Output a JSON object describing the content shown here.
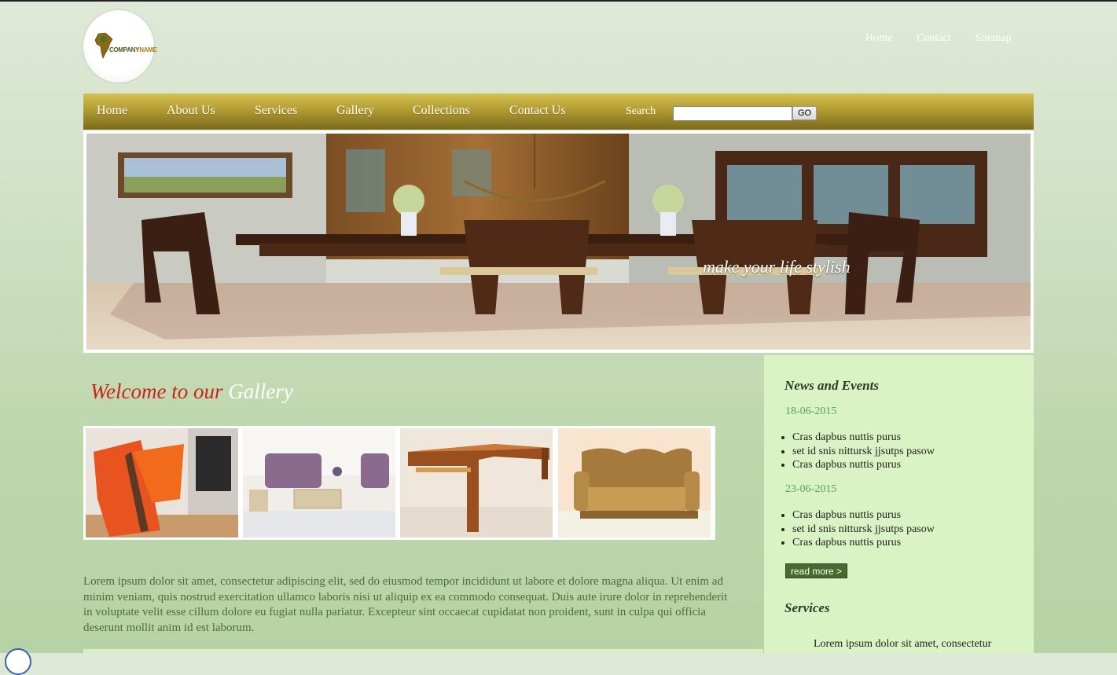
{
  "logo": {
    "company": "COMPANY",
    "name": "NAME"
  },
  "top_links": [
    "Home",
    "Contact",
    "Sitemap"
  ],
  "nav": {
    "items": [
      "Home",
      "About Us",
      "Services",
      "Gallery",
      "Collections",
      "Contact Us"
    ],
    "search_label": "Search",
    "search_value": "",
    "go_label": "GO"
  },
  "banner": {
    "tagline": "make your life stylish"
  },
  "welcome": {
    "part1": "Welcome to our",
    "part2": "Gallery"
  },
  "gallery": {
    "thumbs": [
      "orange-chair",
      "wicker-sofa-set",
      "wooden-bench",
      "sofa"
    ]
  },
  "body_text": "Lorem ipsum dolor sit amet, consectetur adipiscing elit, sed do eiusmod tempor incididunt ut labore et dolore magna aliqua. Ut enim ad minim veniam, quis nostrud exercitation ullamco laboris nisi ut aliquip ex ea commodo consequat. Duis aute irure dolor in reprehenderit in voluptate velit esse cillum dolore eu fugiat nulla pariatur. Excepteur sint occaecat cupidatat non proident, sunt in culpa qui officia deserunt mollit anim id est laborum.",
  "sidebar": {
    "news_title": "News and Events",
    "events": [
      {
        "date": "18-06-2015",
        "items": [
          "Cras dapbus nuttis purus",
          "set id snis nittursk jjsutps pasow",
          "Cras dapbus nuttis purus"
        ]
      },
      {
        "date": "23-06-2015",
        "items": [
          "Cras dapbus nuttis purus",
          "set id snis nittursk jjsutps pasow",
          "Cras dapbus nuttis purus"
        ]
      }
    ],
    "read_more": "read more >",
    "services_title": "Services",
    "services_text": "Lorem ipsum dolor sit amet, consectetur"
  },
  "colors": {
    "nav_gold": "#b29b32",
    "welcome_red": "#d0211c",
    "sidebar_bg": "#d9f3c4",
    "readmore_bg": "#466b2c",
    "date_green": "#5aa05a"
  }
}
